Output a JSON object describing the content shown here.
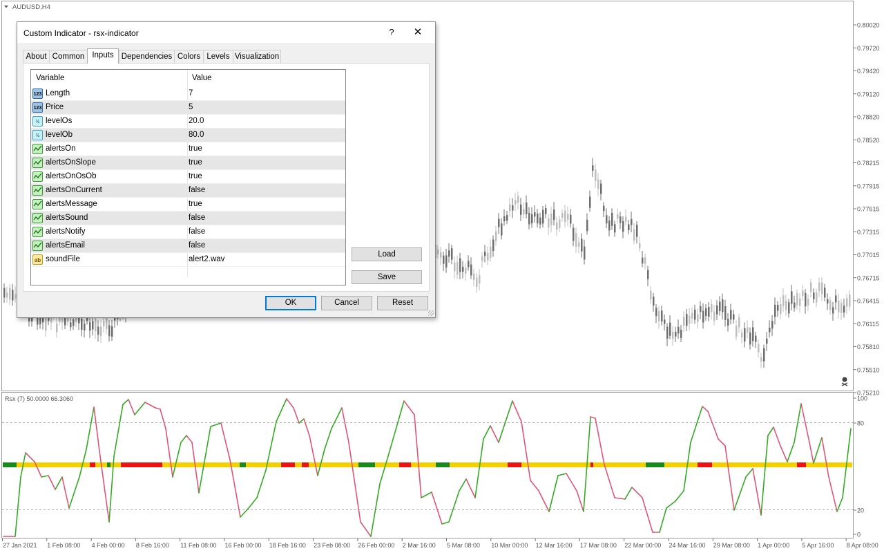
{
  "chart": {
    "symbol_label": "AUDUSD,H4",
    "price_ticks": [
      "0.80020",
      "0.79720",
      "0.79420",
      "0.79120",
      "0.78820",
      "0.78520",
      "0.78215",
      "0.77915",
      "0.77615",
      "0.77315",
      "0.77015",
      "0.76715",
      "0.76415",
      "0.76115",
      "0.75810",
      "0.75510",
      "0.75210"
    ],
    "indicator_label": "Rsx (7) 50.0000 66.3060",
    "indicator_ticks": [
      "100",
      "80",
      "20",
      "0"
    ],
    "time_ticks": [
      "27 Jan 2021",
      "1 Feb 08:00",
      "4 Feb 00:00",
      "8 Feb 16:00",
      "11 Feb 08:00",
      "16 Feb 00:00",
      "18 Feb 16:00",
      "23 Feb 08:00",
      "26 Feb 00:00",
      "2 Mar 16:00",
      "5 Mar 08:00",
      "10 Mar 00:00",
      "12 Mar 16:00",
      "17 Mar 08:00",
      "22 Mar 00:00",
      "24 Mar 16:00",
      "29 Mar 08:00",
      "1 Apr 00:00",
      "5 Apr 16:00",
      "8 Apr 08:00"
    ],
    "colors": {
      "bull": "#bdbdbd",
      "bear": "#6e6e6e",
      "rising": "#33aa22",
      "falling": "#dd5577",
      "band_neutral": "#f5d000",
      "band_up": "#168a1a",
      "band_down": "#ee1111"
    }
  },
  "dialog": {
    "title": "Custom Indicator - rsx-indicator",
    "help_label": "?",
    "close_label": "✕",
    "tabs": [
      {
        "label": "About"
      },
      {
        "label": "Common"
      },
      {
        "label": "Inputs"
      },
      {
        "label": "Dependencies"
      },
      {
        "label": "Colors"
      },
      {
        "label": "Levels"
      },
      {
        "label": "Visualization"
      }
    ],
    "active_tab": "Inputs",
    "grid": {
      "col_variable": "Variable",
      "col_value": "Value",
      "rows": [
        {
          "variable": "Length",
          "value": "7",
          "type": "int",
          "icon_text": "123"
        },
        {
          "variable": "Price",
          "value": "5",
          "type": "int",
          "icon_text": "123"
        },
        {
          "variable": "levelOs",
          "value": "20.0",
          "type": "double",
          "icon_text": "½"
        },
        {
          "variable": "levelOb",
          "value": "80.0",
          "type": "double",
          "icon_text": "½"
        },
        {
          "variable": "alertsOn",
          "value": "true",
          "type": "bool",
          "icon_text": ""
        },
        {
          "variable": "alertsOnSlope",
          "value": "true",
          "type": "bool",
          "icon_text": ""
        },
        {
          "variable": "alertsOnOsOb",
          "value": "true",
          "type": "bool",
          "icon_text": ""
        },
        {
          "variable": "alertsOnCurrent",
          "value": "false",
          "type": "bool",
          "icon_text": ""
        },
        {
          "variable": "alertsMessage",
          "value": "true",
          "type": "bool",
          "icon_text": ""
        },
        {
          "variable": "alertsSound",
          "value": "false",
          "type": "bool",
          "icon_text": ""
        },
        {
          "variable": "alertsNotify",
          "value": "false",
          "type": "bool",
          "icon_text": ""
        },
        {
          "variable": "alertsEmail",
          "value": "false",
          "type": "bool",
          "icon_text": ""
        },
        {
          "variable": "soundFile",
          "value": "alert2.wav",
          "type": "string",
          "icon_text": "ab"
        }
      ]
    },
    "load_label": "Load",
    "save_label": "Save",
    "ok_label": "OK",
    "cancel_label": "Cancel",
    "reset_label": "Reset"
  }
}
